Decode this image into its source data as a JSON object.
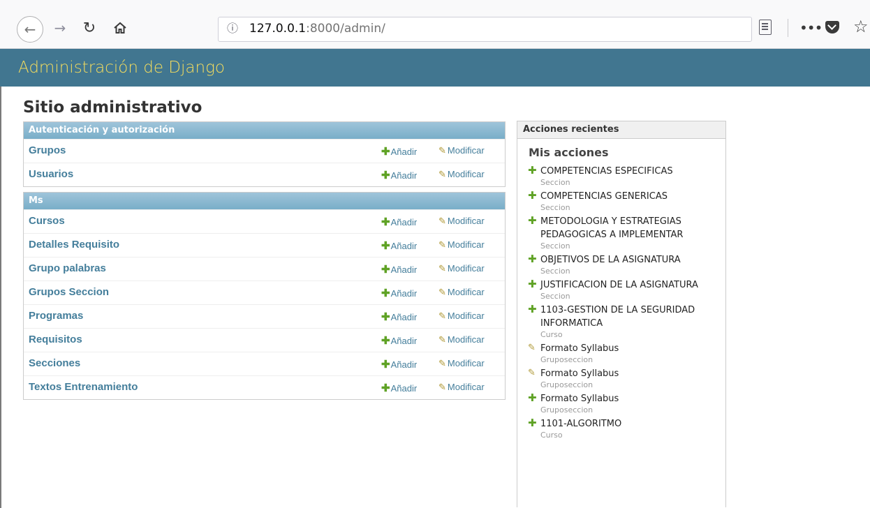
{
  "browser": {
    "url_host": "127.0.0.1",
    "url_rest": ":8000/admin/"
  },
  "header": {
    "title": "Administración de Django"
  },
  "page_title": "Sitio administrativo",
  "modules": [
    {
      "caption": "Autenticación y autorización",
      "rows": [
        {
          "name": "Grupos",
          "add": "Añadir",
          "change": "Modificar"
        },
        {
          "name": "Usuarios",
          "add": "Añadir",
          "change": "Modificar"
        }
      ]
    },
    {
      "caption": "Ms",
      "rows": [
        {
          "name": "Cursos",
          "add": "Añadir",
          "change": "Modificar"
        },
        {
          "name": "Detalles Requisito",
          "add": "Añadir",
          "change": "Modificar"
        },
        {
          "name": "Grupo palabras",
          "add": "Añadir",
          "change": "Modificar"
        },
        {
          "name": "Grupos Seccion",
          "add": "Añadir",
          "change": "Modificar"
        },
        {
          "name": "Programas",
          "add": "Añadir",
          "change": "Modificar"
        },
        {
          "name": "Requisitos",
          "add": "Añadir",
          "change": "Modificar"
        },
        {
          "name": "Secciones",
          "add": "Añadir",
          "change": "Modificar"
        },
        {
          "name": "Textos Entrenamiento",
          "add": "Añadir",
          "change": "Modificar"
        }
      ]
    }
  ],
  "recent": {
    "caption": "Acciones recientes",
    "heading": "Mis acciones",
    "items": [
      {
        "label": "COMPETENCIAS ESPECIFICAS",
        "type": "Seccion",
        "icon": "add-icon"
      },
      {
        "label": "COMPETENCIAS GENERICAS",
        "type": "Seccion",
        "icon": "add-icon"
      },
      {
        "label": "METODOLOGIA Y ESTRATEGIAS PEDAGOGICAS A IMPLEMENTAR",
        "type": "Seccion",
        "icon": "add-icon"
      },
      {
        "label": "OBJETIVOS DE LA ASIGNATURA",
        "type": "Seccion",
        "icon": "add-icon"
      },
      {
        "label": "JUSTIFICACION DE LA ASIGNATURA",
        "type": "Seccion",
        "icon": "add-icon"
      },
      {
        "label": "1103-GESTION DE LA SEGURIDAD INFORMATICA",
        "type": "Curso",
        "icon": "add-icon"
      },
      {
        "label": "Formato Syllabus",
        "type": "Gruposeccion",
        "icon": "pencil-icon"
      },
      {
        "label": "Formato Syllabus",
        "type": "Gruposeccion",
        "icon": "pencil-icon"
      },
      {
        "label": "Formato Syllabus",
        "type": "Gruposeccion",
        "icon": "add-icon"
      },
      {
        "label": "1101-ALGORITMO",
        "type": "Curso",
        "icon": "add-icon"
      }
    ]
  },
  "colors": {
    "header_bg": "#417690",
    "header_text": "#f5dd5d",
    "link": "#447e9b",
    "add_green": "#5fa225"
  }
}
